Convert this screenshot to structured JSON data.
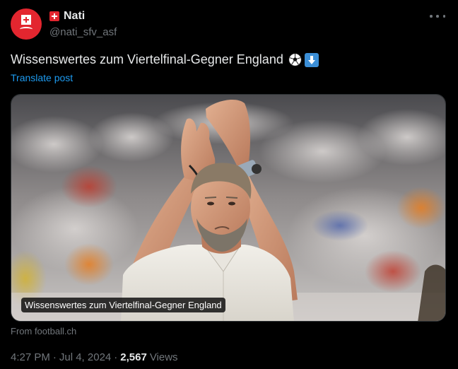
{
  "author": {
    "display_name": "Nati",
    "handle": "@nati_sfv_asf"
  },
  "post": {
    "text": "Wissenswertes zum Viertelfinal-Gegner England",
    "emoji_icons": [
      "soccer-ball-icon",
      "down-arrow-icon"
    ],
    "translate_label": "Translate post"
  },
  "card": {
    "caption": "Wissenswertes zum Viertelfinal-Gegner England",
    "source": "From football.ch"
  },
  "meta": {
    "time": "4:27 PM",
    "separator": "·",
    "date": "Jul 4, 2024",
    "views_count": "2,567",
    "views_label": "Views"
  },
  "colors": {
    "background": "#000000",
    "text": "#e7e9ea",
    "secondary": "#71767b",
    "link": "#1d9bf0",
    "swiss_red": "#e3262f"
  }
}
